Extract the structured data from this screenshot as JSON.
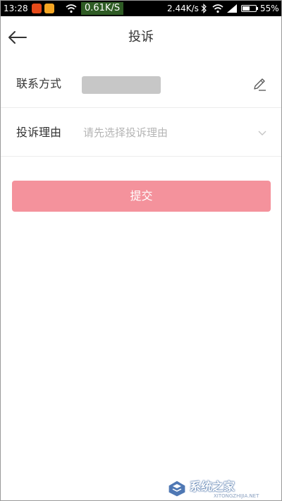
{
  "status_bar": {
    "time": "13:28",
    "app_icons": [
      "weibo-app-icon",
      "notes-app-icon"
    ],
    "net_speed_highlight": "0.61K/S",
    "net_speed": "2.44K/s",
    "battery_level": 0.55,
    "battery_percent": "55%"
  },
  "header": {
    "title": "投诉",
    "back_icon": "arrow-left-icon"
  },
  "form": {
    "contact": {
      "label": "联系方式",
      "value_redacted": true,
      "edit_icon": "pencil-icon"
    },
    "reason": {
      "label": "投诉理由",
      "placeholder": "请先选择投诉理由",
      "chevron_icon": "chevron-down-icon"
    }
  },
  "submit": {
    "label": "提交",
    "color": "#f4929c"
  },
  "watermark": {
    "text": "系统之家",
    "url": "XITONGZHIJIA.NET"
  },
  "colors": {
    "accent": "#f4929c",
    "status_bar_bg": "#000000",
    "speed_highlight_bg": "#2e5b24"
  }
}
